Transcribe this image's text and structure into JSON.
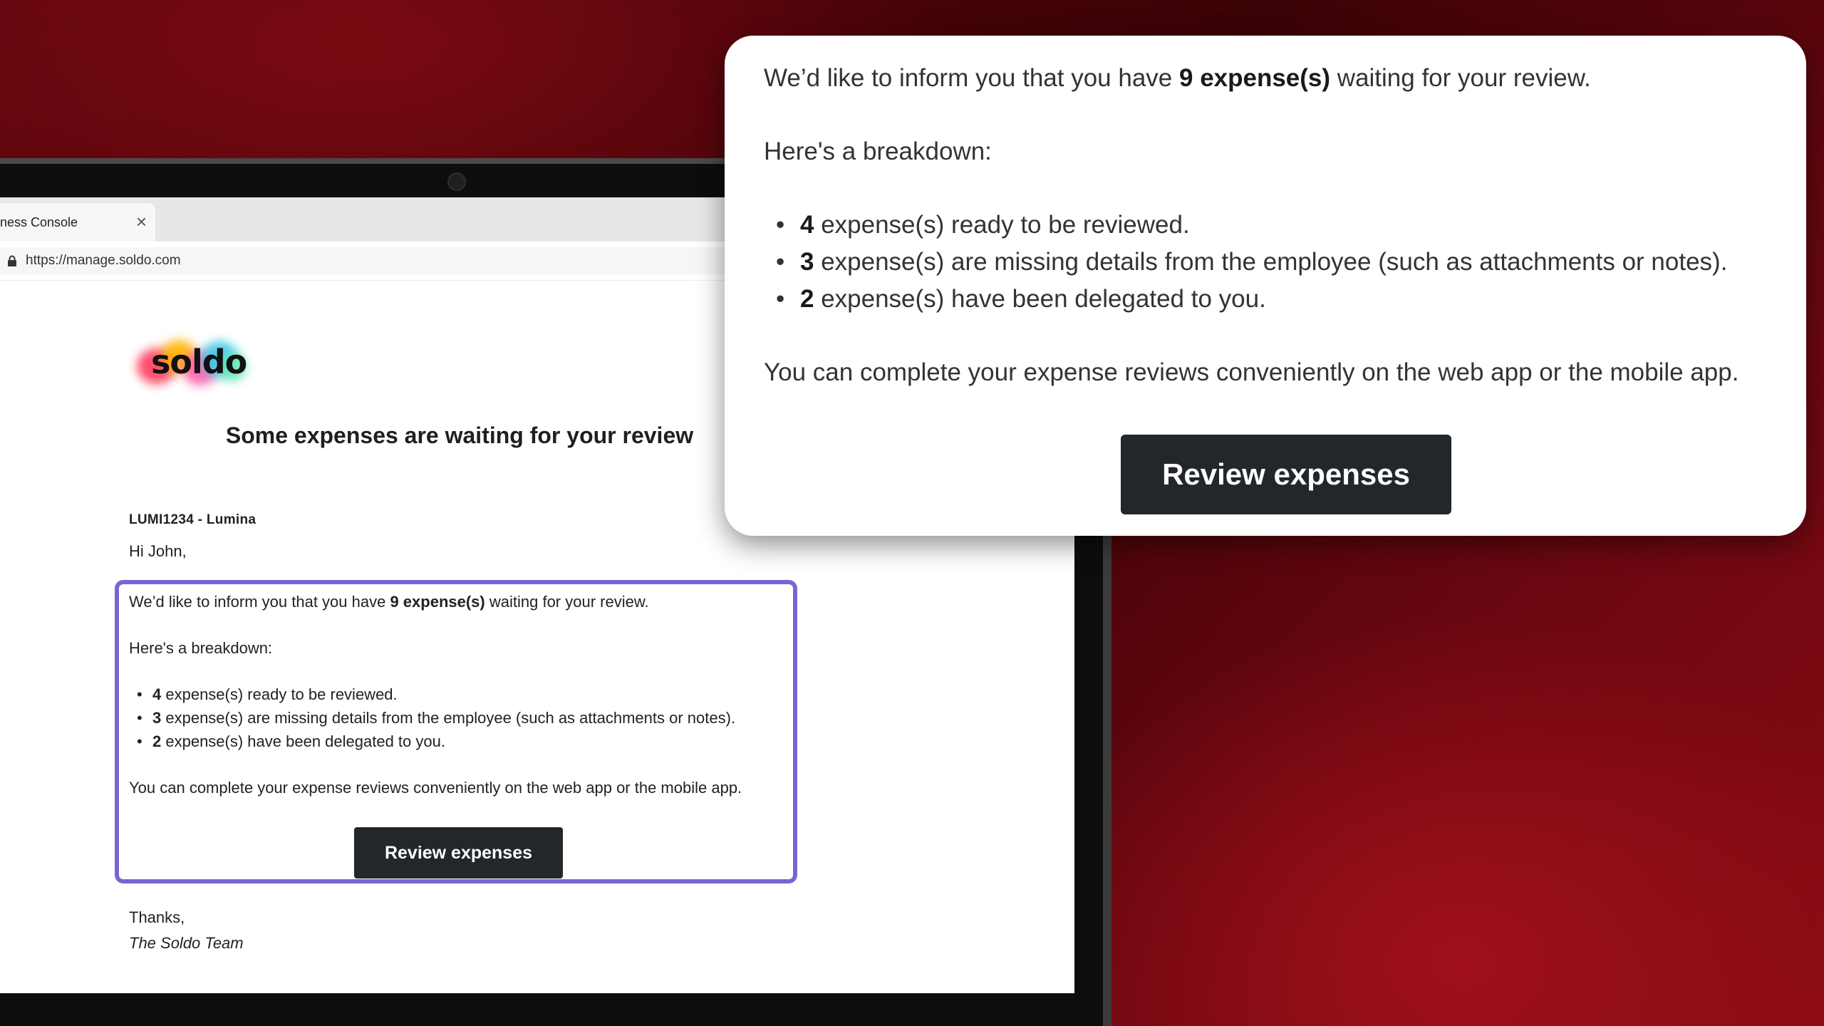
{
  "browser": {
    "tab_label": "ness Console",
    "tab_close_glyph": "×",
    "url": "https://manage.soldo.com"
  },
  "email": {
    "logo_text": "soldo",
    "title": "Some expenses are waiting for your review",
    "org_line": "LUMI1234 - Lumina",
    "greeting": "Hi John,",
    "intro_prefix": "We’d like to inform you that you have ",
    "intro_count": "9 expense(s)",
    "intro_suffix": " waiting for your review.",
    "breakdown_heading": "Here's a breakdown:",
    "bullets": [
      {
        "count": "4",
        "text": " expense(s) ready to be reviewed."
      },
      {
        "count": "3",
        "text": " expense(s) are missing details from the employee (such as attachments or notes)."
      },
      {
        "count": "2",
        "text": " expense(s) have been delegated to you."
      }
    ],
    "closing_note": "You can complete your expense reviews conveniently on the web app or the mobile app.",
    "button_label": "Review expenses",
    "thanks": "Thanks,",
    "signature": "The Soldo Team",
    "highlight_color": "#7b63d4"
  },
  "icons": {
    "lock": "lock-icon",
    "close": "close-icon",
    "camera": "camera-icon",
    "bullet": "bullet-icon"
  },
  "colors": {
    "button_bg": "#23272b",
    "background_red": "#6b0710"
  }
}
